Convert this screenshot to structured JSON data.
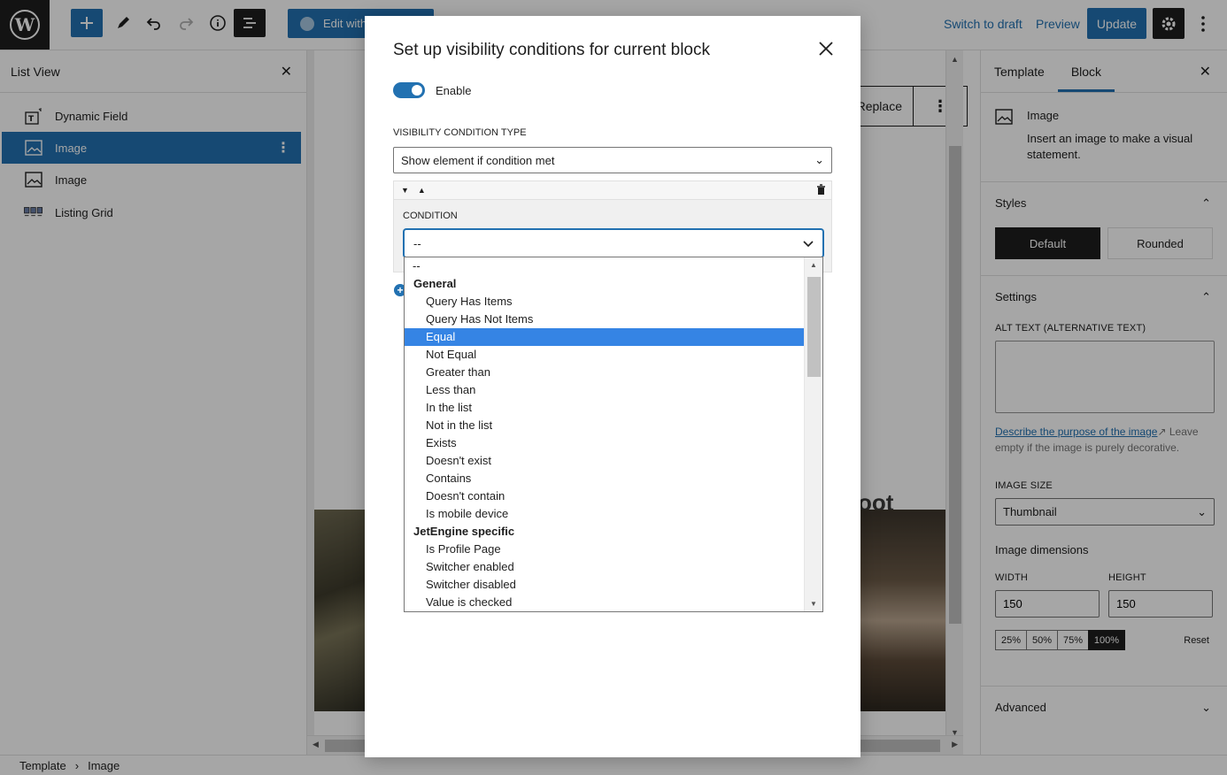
{
  "topbar": {
    "add_icon": "plus-icon",
    "edit_with": "Edit with",
    "switch_to_draft": "Switch to draft",
    "preview": "Preview",
    "update": "Update"
  },
  "list_view": {
    "title": "List View",
    "items": [
      {
        "label": "Dynamic Field",
        "icon": "dynamic-field-icon"
      },
      {
        "label": "Image",
        "icon": "image-icon",
        "selected": true
      },
      {
        "label": "Image",
        "icon": "image-icon"
      },
      {
        "label": "Listing Grid",
        "icon": "listing-grid-icon"
      }
    ]
  },
  "canvas": {
    "replace": "Replace",
    "photo_caption_fragment": "oot"
  },
  "sidebar": {
    "tabs": [
      "Template",
      "Block"
    ],
    "active_tab": "Block",
    "block_title": "Image",
    "block_desc": "Insert an image to make a visual statement.",
    "styles_title": "Styles",
    "style_default": "Default",
    "style_rounded": "Rounded",
    "settings_title": "Settings",
    "alt_label": "ALT TEXT (ALTERNATIVE TEXT)",
    "alt_value": "",
    "help_link": "Describe the purpose of the image",
    "help_rest": "Leave empty if the image is purely decorative.",
    "image_size_label": "IMAGE SIZE",
    "image_size_value": "Thumbnail",
    "dimensions_title": "Image dimensions",
    "width_label": "WIDTH",
    "height_label": "HEIGHT",
    "width_value": "150",
    "height_value": "150",
    "pct_options": [
      "25%",
      "50%",
      "75%",
      "100%"
    ],
    "pct_active": "100%",
    "reset": "Reset",
    "advanced_title": "Advanced"
  },
  "breadcrumb": [
    "Template",
    "Image"
  ],
  "modal": {
    "title": "Set up visibility conditions for current block",
    "enable_label": "Enable",
    "enabled": true,
    "condition_type_label": "VISIBILITY CONDITION TYPE",
    "condition_type_value": "Show element if condition met",
    "condition_label": "CONDITION",
    "condition_value": "--",
    "dropdown": [
      {
        "kind": "top",
        "label": "--"
      },
      {
        "kind": "group",
        "label": "General"
      },
      {
        "kind": "opt",
        "label": "Query Has Items"
      },
      {
        "kind": "opt",
        "label": "Query Has Not Items"
      },
      {
        "kind": "opt",
        "label": "Equal",
        "selected": true
      },
      {
        "kind": "opt",
        "label": "Not Equal"
      },
      {
        "kind": "opt",
        "label": "Greater than"
      },
      {
        "kind": "opt",
        "label": "Less than"
      },
      {
        "kind": "opt",
        "label": "In the list"
      },
      {
        "kind": "opt",
        "label": "Not in the list"
      },
      {
        "kind": "opt",
        "label": "Exists"
      },
      {
        "kind": "opt",
        "label": "Doesn't exist"
      },
      {
        "kind": "opt",
        "label": "Contains"
      },
      {
        "kind": "opt",
        "label": "Doesn't contain"
      },
      {
        "kind": "opt",
        "label": "Is mobile device"
      },
      {
        "kind": "group",
        "label": "JetEngine specific"
      },
      {
        "kind": "opt",
        "label": "Is Profile Page"
      },
      {
        "kind": "opt",
        "label": "Switcher enabled"
      },
      {
        "kind": "opt",
        "label": "Switcher disabled"
      },
      {
        "kind": "opt",
        "label": "Value is checked"
      }
    ]
  }
}
